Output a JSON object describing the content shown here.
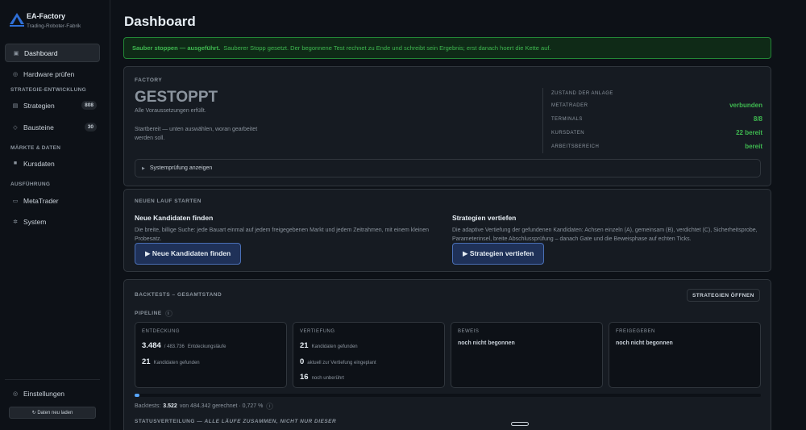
{
  "brand": {
    "name": "EA-Factory",
    "subtitle": "Trading-Roboter-Fabrik"
  },
  "nav": {
    "dashboard": "Dashboard",
    "hardware": "Hardware prüfen",
    "section_strategy": "STRATEGIE-ENTWICKLUNG",
    "strategies": {
      "label": "Strategien",
      "badge": "808"
    },
    "blocks": {
      "label": "Bausteine",
      "badge": "30"
    },
    "section_markets": "MÄRKTE & DATEN",
    "price_data": "Kursdaten",
    "section_execution": "AUSFÜHRUNG",
    "metatrader": "MetaTrader",
    "system": "System",
    "settings": "Einstellungen",
    "reload": "↻ Daten neu laden"
  },
  "page": {
    "title": "Dashboard"
  },
  "alert": {
    "strong": "Sauber stoppen — ausgeführt.",
    "text": "Sauberer Stopp gesetzt. Der begonnene Test rechnet zu Ende und schreibt sein Ergebnis; erst danach hoert die Kette auf."
  },
  "factory": {
    "label": "FACTORY",
    "status": "GESTOPPT",
    "status_sub": "Alle Voraussetzungen erfüllt.",
    "hint": "Startbereit — unten auswählen, woran gearbeitet werden soll.",
    "state_title": "ZUSTAND DER ANLAGE",
    "rows": [
      {
        "key": "METATRADER",
        "value": "verbunden"
      },
      {
        "key": "TERMINALS",
        "value": "8/8"
      },
      {
        "key": "KURSDATEN",
        "value": "22 bereit"
      },
      {
        "key": "ARBEITSBEREICH",
        "value": "bereit"
      }
    ],
    "syscheck": "Systemprüfung anzeigen",
    "status_color": "#8b949e",
    "ok_color": "#3fb950"
  },
  "new_run": {
    "label": "NEUEN LAUF STARTEN",
    "find": {
      "title": "Neue Kandidaten finden",
      "desc": "Die breite, billige Suche: jede Bauart einmal auf jedem freigegebenen Markt und jedem Zeitrahmen, mit einem kleinen Probesatz.",
      "button": "▶ Neue Kandidaten finden"
    },
    "deepen": {
      "title": "Strategien vertiefen",
      "desc": "Die adaptive Vertiefung der gefundenen Kandidaten: Achsen einzeln (A), gemeinsam (B), verdichtet (C), Sicherheitsprobe, Parameterinsel, breite Abschlussprüfung – danach Gate und die Beweisphase auf echten Ticks.",
      "button": "▶ Strategien vertiefen"
    }
  },
  "backtests": {
    "label": "BACKTESTS – GESAMTSTAND",
    "open_button": "STRATEGIEN ÖFFNEN",
    "pipeline_label": "PIPELINE",
    "info": "i",
    "stages": {
      "discovery": {
        "title": "ENTDECKUNG",
        "runs_value": "3.484",
        "runs_total": "/ 483.736",
        "runs_label": "Entdeckungsläufe",
        "found_value": "21",
        "found_label": "Kandidaten gefunden"
      },
      "deepening": {
        "title": "VERTIEFUNG",
        "found_value": "21",
        "found_label": "Kandidaten gefunden",
        "planned_value": "0",
        "planned_label": "aktuell zur Vertiefung eingeplant",
        "untouched_value": "16",
        "untouched_label": "noch unberührt"
      },
      "proof": {
        "title": "BEWEIS",
        "status": "noch nicht begonnen"
      },
      "released": {
        "title": "FREIGEGEBEN",
        "status": "noch nicht begonnen"
      }
    },
    "progress_fraction": 0.00727,
    "summary_prefix": "Backtests:",
    "summary_done": "3.522",
    "summary_rest": "von 484.342 gerechnet · 0,727 %",
    "accent": "#58a6ff"
  },
  "status_dist": {
    "label": "STATUSVERTEILUNG —",
    "note": "ALLE LÄUFE ZUSAMMEN, NICHT NUR DIESER"
  }
}
